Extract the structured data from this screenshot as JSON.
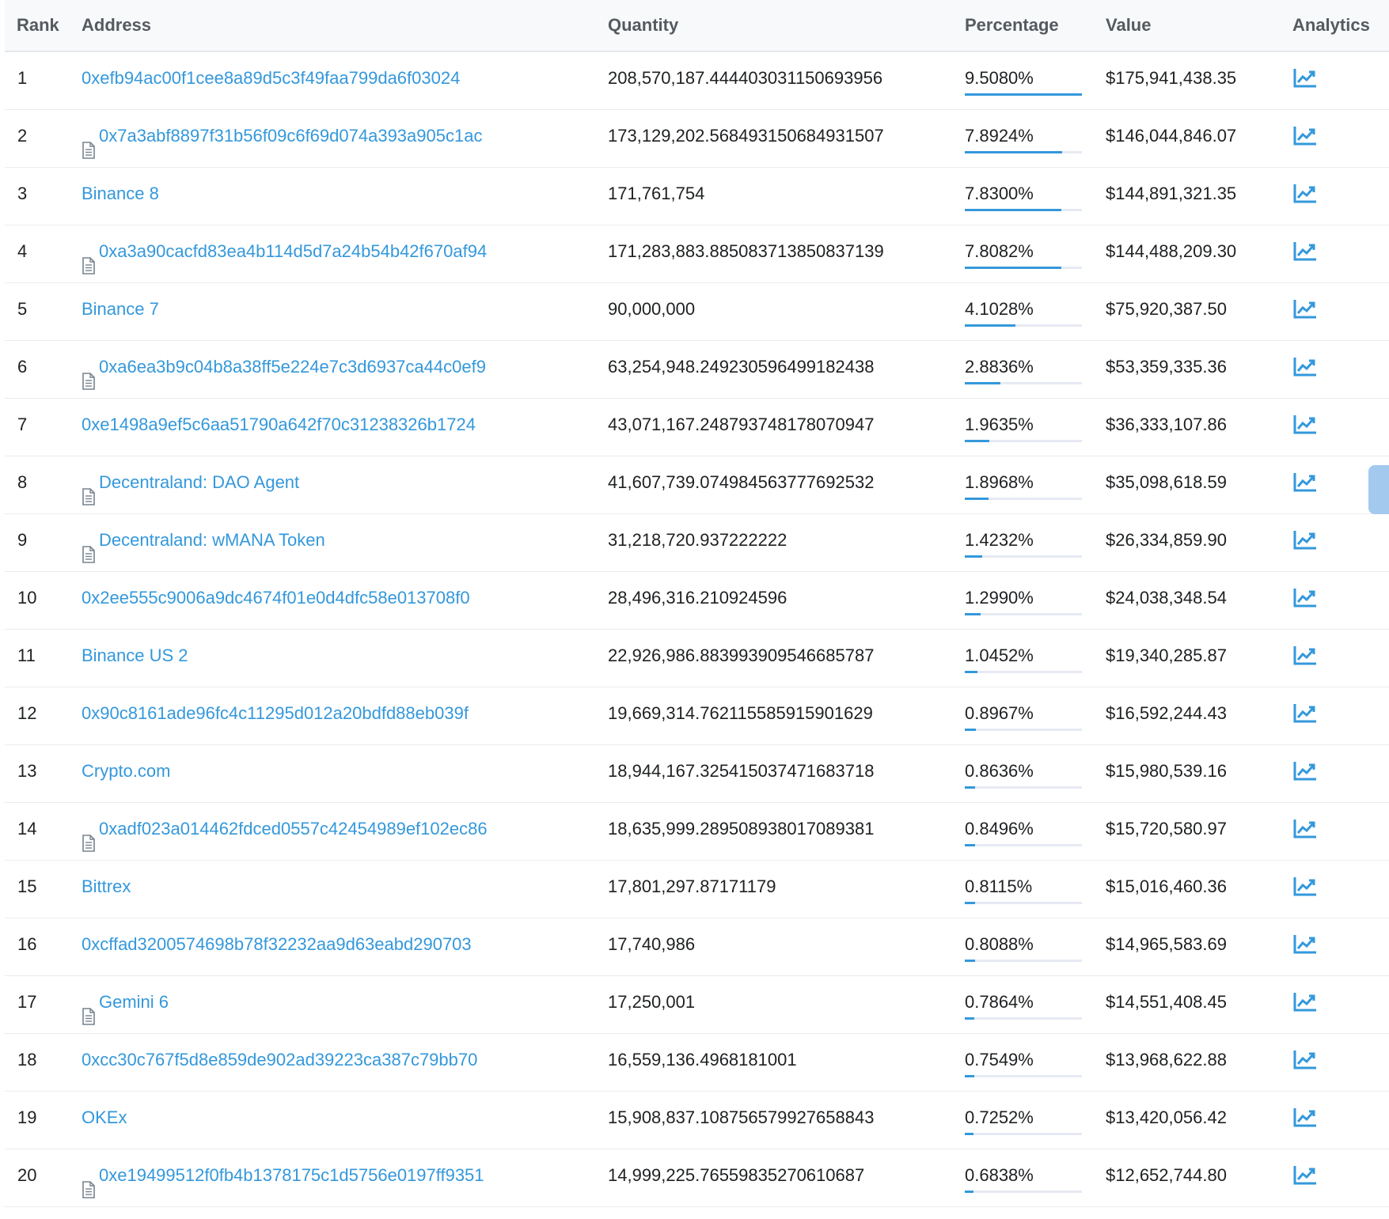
{
  "colors": {
    "link": "#3498db",
    "text": "#1e2022",
    "header_bg": "#f8f9fa",
    "bar_track": "#e7eaf3"
  },
  "header": {
    "rank": "Rank",
    "address": "Address",
    "quantity": "Quantity",
    "percentage": "Percentage",
    "value": "Value",
    "analytics": "Analytics"
  },
  "rows": [
    {
      "rank": "1",
      "address": "0xefb94ac00f1cee8a89d5c3f49faa799da6f03024",
      "contract": false,
      "quantity": "208,570,187.444403031150693956",
      "percentage": "9.5080%",
      "pct_value": 9.508,
      "value": "$175,941,438.35",
      "analytics_icon": "chart-line-icon"
    },
    {
      "rank": "2",
      "address": "0x7a3abf8897f31b56f09c6f69d074a393a905c1ac",
      "contract": true,
      "quantity": "173,129,202.568493150684931507",
      "percentage": "7.8924%",
      "pct_value": 7.8924,
      "value": "$146,044,846.07",
      "analytics_icon": "chart-line-icon"
    },
    {
      "rank": "3",
      "address": "Binance 8",
      "contract": false,
      "quantity": "171,761,754",
      "percentage": "7.8300%",
      "pct_value": 7.83,
      "value": "$144,891,321.35",
      "analytics_icon": "chart-line-icon"
    },
    {
      "rank": "4",
      "address": "0xa3a90cacfd83ea4b114d5d7a24b54b42f670af94",
      "contract": true,
      "quantity": "171,283,883.885083713850837139",
      "percentage": "7.8082%",
      "pct_value": 7.8082,
      "value": "$144,488,209.30",
      "analytics_icon": "chart-line-icon"
    },
    {
      "rank": "5",
      "address": "Binance 7",
      "contract": false,
      "quantity": "90,000,000",
      "percentage": "4.1028%",
      "pct_value": 4.1028,
      "value": "$75,920,387.50",
      "analytics_icon": "chart-line-icon"
    },
    {
      "rank": "6",
      "address": "0xa6ea3b9c04b8a38ff5e224e7c3d6937ca44c0ef9",
      "contract": true,
      "quantity": "63,254,948.249230596499182438",
      "percentage": "2.8836%",
      "pct_value": 2.8836,
      "value": "$53,359,335.36",
      "analytics_icon": "chart-line-icon"
    },
    {
      "rank": "7",
      "address": "0xe1498a9ef5c6aa51790a642f70c31238326b1724",
      "contract": false,
      "quantity": "43,071,167.248793748178070947",
      "percentage": "1.9635%",
      "pct_value": 1.9635,
      "value": "$36,333,107.86",
      "analytics_icon": "chart-line-icon"
    },
    {
      "rank": "8",
      "address": "Decentraland: DAO Agent",
      "contract": true,
      "quantity": "41,607,739.074984563777692532",
      "percentage": "1.8968%",
      "pct_value": 1.8968,
      "value": "$35,098,618.59",
      "analytics_icon": "chart-line-icon"
    },
    {
      "rank": "9",
      "address": "Decentraland: wMANA Token",
      "contract": true,
      "quantity": "31,218,720.937222222",
      "percentage": "1.4232%",
      "pct_value": 1.4232,
      "value": "$26,334,859.90",
      "analytics_icon": "chart-line-icon"
    },
    {
      "rank": "10",
      "address": "0x2ee555c9006a9dc4674f01e0d4dfc58e013708f0",
      "contract": false,
      "quantity": "28,496,316.210924596",
      "percentage": "1.2990%",
      "pct_value": 1.299,
      "value": "$24,038,348.54",
      "analytics_icon": "chart-line-icon"
    },
    {
      "rank": "11",
      "address": "Binance US 2",
      "contract": false,
      "quantity": "22,926,986.883993909546685787",
      "percentage": "1.0452%",
      "pct_value": 1.0452,
      "value": "$19,340,285.87",
      "analytics_icon": "chart-line-icon"
    },
    {
      "rank": "12",
      "address": "0x90c8161ade96fc4c11295d012a20bdfd88eb039f",
      "contract": false,
      "quantity": "19,669,314.762115585915901629",
      "percentage": "0.8967%",
      "pct_value": 0.8967,
      "value": "$16,592,244.43",
      "analytics_icon": "chart-line-icon"
    },
    {
      "rank": "13",
      "address": "Crypto.com",
      "contract": false,
      "quantity": "18,944,167.325415037471683718",
      "percentage": "0.8636%",
      "pct_value": 0.8636,
      "value": "$15,980,539.16",
      "analytics_icon": "chart-line-icon"
    },
    {
      "rank": "14",
      "address": "0xadf023a014462fdced0557c42454989ef102ec86",
      "contract": true,
      "quantity": "18,635,999.289508938017089381",
      "percentage": "0.8496%",
      "pct_value": 0.8496,
      "value": "$15,720,580.97",
      "analytics_icon": "chart-line-icon"
    },
    {
      "rank": "15",
      "address": "Bittrex",
      "contract": false,
      "quantity": "17,801,297.87171179",
      "percentage": "0.8115%",
      "pct_value": 0.8115,
      "value": "$15,016,460.36",
      "analytics_icon": "chart-line-icon"
    },
    {
      "rank": "16",
      "address": "0xcffad3200574698b78f32232aa9d63eabd290703",
      "contract": false,
      "quantity": "17,740,986",
      "percentage": "0.8088%",
      "pct_value": 0.8088,
      "value": "$14,965,583.69",
      "analytics_icon": "chart-line-icon"
    },
    {
      "rank": "17",
      "address": "Gemini 6",
      "contract": true,
      "quantity": "17,250,001",
      "percentage": "0.7864%",
      "pct_value": 0.7864,
      "value": "$14,551,408.45",
      "analytics_icon": "chart-line-icon"
    },
    {
      "rank": "18",
      "address": "0xcc30c767f5d8e859de902ad39223ca387c79bb70",
      "contract": false,
      "quantity": "16,559,136.4968181001",
      "percentage": "0.7549%",
      "pct_value": 0.7549,
      "value": "$13,968,622.88",
      "analytics_icon": "chart-line-icon"
    },
    {
      "rank": "19",
      "address": "OKEx",
      "contract": false,
      "quantity": "15,908,837.108756579927658843",
      "percentage": "0.7252%",
      "pct_value": 0.7252,
      "value": "$13,420,056.42",
      "analytics_icon": "chart-line-icon"
    },
    {
      "rank": "20",
      "address": "0xe19499512f0fb4b1378175c1d5756e0197ff9351",
      "contract": true,
      "quantity": "14,999,225.76559835270610687",
      "percentage": "0.6838%",
      "pct_value": 0.6838,
      "value": "$12,652,744.80",
      "analytics_icon": "chart-line-icon"
    }
  ]
}
